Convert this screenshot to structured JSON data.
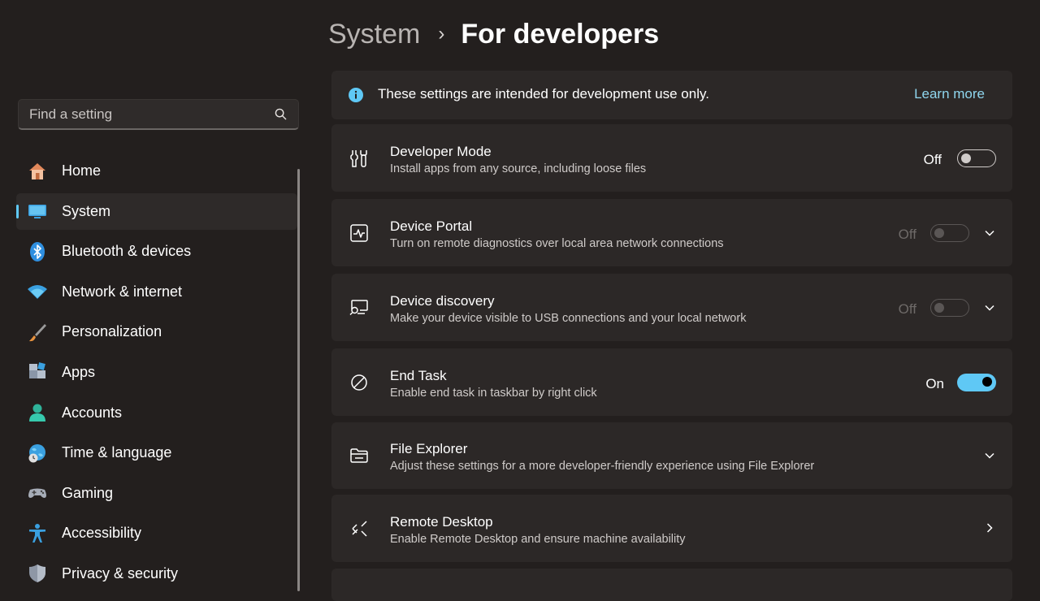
{
  "header": {
    "breadcrumb_parent": "System",
    "separator": "›",
    "page_title": "For developers"
  },
  "search": {
    "placeholder": "Find a setting",
    "icon": "search-icon"
  },
  "sidebar": {
    "items": [
      {
        "label": "Home",
        "icon": "home-icon"
      },
      {
        "label": "System",
        "icon": "monitor-icon",
        "active": true
      },
      {
        "label": "Bluetooth & devices",
        "icon": "bluetooth-icon"
      },
      {
        "label": "Network & internet",
        "icon": "wifi-icon"
      },
      {
        "label": "Personalization",
        "icon": "brush-icon"
      },
      {
        "label": "Apps",
        "icon": "apps-icon"
      },
      {
        "label": "Accounts",
        "icon": "person-icon"
      },
      {
        "label": "Time & language",
        "icon": "globe-clock-icon"
      },
      {
        "label": "Gaming",
        "icon": "gamepad-icon"
      },
      {
        "label": "Accessibility",
        "icon": "accessibility-icon"
      },
      {
        "label": "Privacy & security",
        "icon": "shield-icon"
      }
    ]
  },
  "banner": {
    "text": "These settings are intended for development use only.",
    "link": "Learn more",
    "icon": "info-icon"
  },
  "settings": [
    {
      "title": "Developer Mode",
      "subtitle": "Install apps from any source, including loose files",
      "state": "Off",
      "toggle": "off",
      "enabled": true,
      "icon": "developer-tools-icon"
    },
    {
      "title": "Device Portal",
      "subtitle": "Turn on remote diagnostics over local area network connections",
      "state": "Off",
      "toggle": "off",
      "enabled": false,
      "icon": "pulse-monitor-icon"
    },
    {
      "title": "Device discovery",
      "subtitle": "Make your device visible to USB connections and your local network",
      "state": "Off",
      "toggle": "off",
      "enabled": false,
      "icon": "device-search-icon"
    },
    {
      "title": "End Task",
      "subtitle": "Enable end task in taskbar by right click",
      "state": "On",
      "toggle": "on",
      "enabled": true,
      "icon": "block-icon"
    },
    {
      "title": "File Explorer",
      "subtitle": "Adjust these settings for a more developer-friendly experience using File Explorer",
      "icon": "folder-icon"
    },
    {
      "title": "Remote Desktop",
      "subtitle": "Enable Remote Desktop and ensure machine availability",
      "icon": "remote-desktop-icon"
    }
  ],
  "colors": {
    "accent": "#5fc8f5",
    "background": "#231f1e",
    "card": "#2c2827",
    "link": "#8fd6ee"
  }
}
